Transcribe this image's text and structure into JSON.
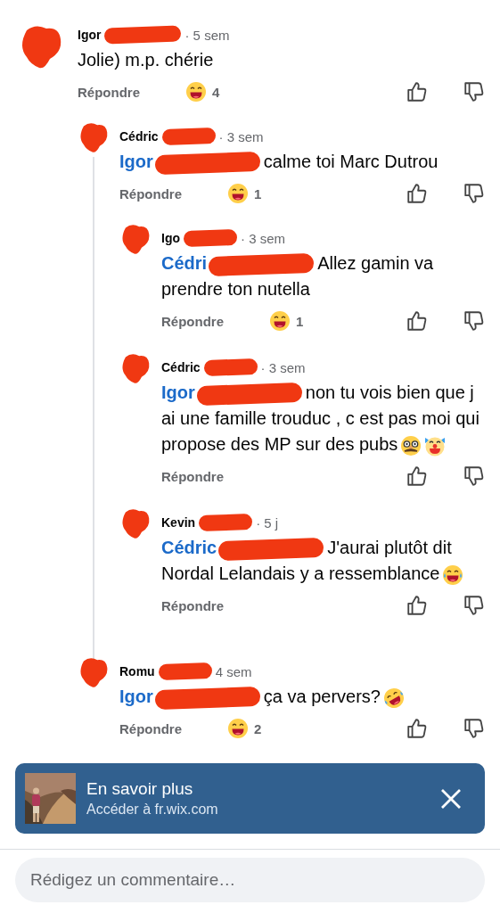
{
  "comments": [
    {
      "author": "Igor",
      "time": "· 5 sem",
      "text": "Jolie) m.p. chérie",
      "reply_label": "Répondre",
      "reaction": {
        "kind": "haha",
        "count": "4"
      },
      "children": [
        {
          "author": "Cédric",
          "time": "· 3 sem",
          "mention": "Igor",
          "text": "calme toi Marc Dutrou",
          "reply_label": "Répondre",
          "reaction": {
            "kind": "haha",
            "count": "1"
          },
          "children": [
            {
              "author": "Igo",
              "time": "· 3 sem",
              "mention": "Cédri",
              "text": "Allez gamin va prendre ton nutella",
              "reply_label": "Répondre",
              "reaction": {
                "kind": "haha",
                "count": "1"
              }
            },
            {
              "author": "Cédric",
              "time": "· 3 sem",
              "mention": "Igor",
              "text": "non tu vois bien que j ai une famille trouduc , c est pas moi qui propose des MP sur des pubs",
              "emojis": [
                {
                  "kind": "disguise"
                },
                {
                  "kind": "clown"
                }
              ],
              "reply_label": "Répondre"
            },
            {
              "author": "Kevin",
              "time": "· 5 j",
              "mention": "Cédric",
              "text": "J'aurai plutôt dit Nordal Lelandais y a ressemblance",
              "emojis": [
                {
                  "kind": "tears"
                }
              ],
              "reply_label": "Répondre"
            }
          ]
        },
        {
          "author": "Romu",
          "time": "4 sem",
          "mention": "Igor",
          "text": "ça va pervers?",
          "emojis": [
            {
              "kind": "rolling"
            }
          ],
          "reply_label": "Répondre",
          "reaction": {
            "kind": "haha",
            "count": "2"
          }
        }
      ]
    }
  ],
  "banner": {
    "title": "En savoir plus",
    "subtitle": "Accéder à fr.wix.com"
  },
  "composer": {
    "placeholder": "Rédigez un commentaire…"
  }
}
